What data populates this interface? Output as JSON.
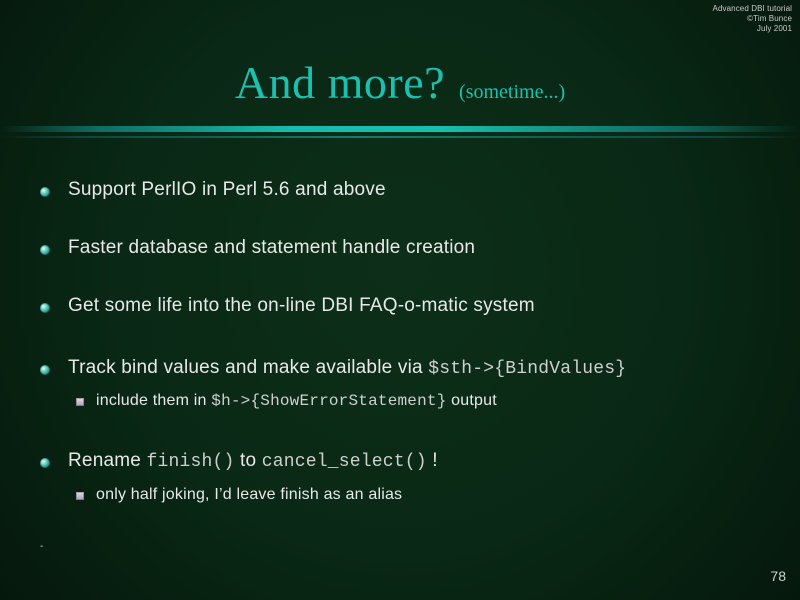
{
  "meta": {
    "line1": "Advanced DBI tutorial",
    "line2": "©Tim Bunce",
    "line3": "July 2001"
  },
  "title": {
    "main": "And more?",
    "sub": "(sometime...)"
  },
  "bullets": [
    {
      "text": "Support PerlIO in Perl 5.6 and above"
    },
    {
      "text": "Faster database and statement handle creation"
    },
    {
      "text": "Get some life into the on-line DBI FAQ-o-matic system"
    },
    {
      "text_before": "Track bind values and make available via ",
      "code": "$sth->{BindValues}",
      "sub": {
        "text_before": "include them in ",
        "code": "$h->{ShowErrorStatement}",
        "text_after": " output"
      }
    },
    {
      "text_before": "Rename ",
      "code1": "finish()",
      "text_middle": " to ",
      "code2": "cancel_select()",
      "text_after": " !",
      "sub": {
        "text": "only half joking, I’d leave finish as an alias"
      }
    }
  ],
  "footer": {
    "dash": "-",
    "page_number": "78"
  },
  "colors": {
    "title": "#19c2b0",
    "text": "#e8e8e8",
    "accent_bar": "#16c2b2",
    "bullet_dot": "#71d8c8",
    "sub_square": "#d2c1d4"
  }
}
